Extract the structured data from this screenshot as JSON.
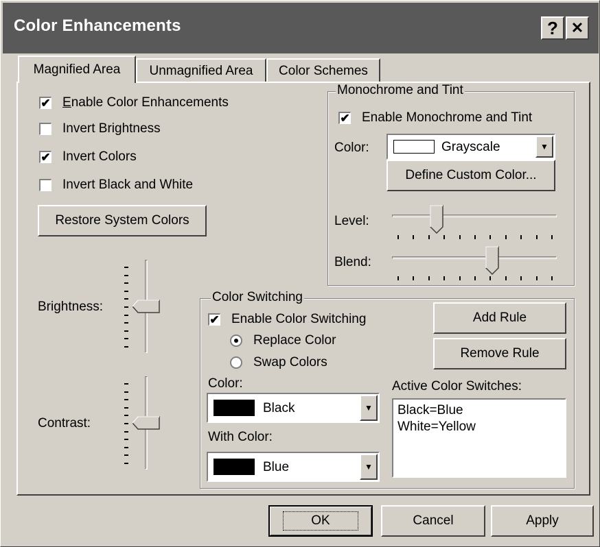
{
  "window": {
    "title": "Color Enhancements",
    "help_glyph": "?",
    "close_glyph": "✕"
  },
  "tabs": [
    {
      "label": "Magnified Area",
      "active": true
    },
    {
      "label": "Unmagnified Area",
      "active": false
    },
    {
      "label": "Color Schemes",
      "active": false
    }
  ],
  "magnified": {
    "options": [
      {
        "label": "Enable Color Enhancements",
        "checked": true
      },
      {
        "label": "Invert Brightness",
        "checked": false
      },
      {
        "label": "Invert Colors",
        "checked": true
      },
      {
        "label": "Invert Black and White",
        "checked": false
      }
    ],
    "restore_button": "Restore System Colors",
    "brightness_label": "Brightness:",
    "contrast_label": "Contrast:",
    "brightness_level": 0.5,
    "contrast_level": 0.5
  },
  "monochrome": {
    "group_label": "Monochrome and Tint",
    "enable_label": "Enable Monochrome and Tint",
    "enable_checked": true,
    "color_label": "Color:",
    "color_value": "Grayscale",
    "define_button": "Define Custom Color...",
    "level_label": "Level:",
    "blend_label": "Blend:",
    "level_value": 0.25,
    "blend_value": 0.62
  },
  "switching": {
    "group_label": "Color Switching",
    "enable_label": "Enable Color Switching",
    "enable_checked": true,
    "replace_label": "Replace Color",
    "swap_label": "Swap Colors",
    "replace_selected": true,
    "color_label": "Color:",
    "color_value": "Black",
    "with_color_label": "With Color:",
    "with_color_value": "Blue",
    "add_rule": "Add Rule",
    "remove_rule": "Remove Rule",
    "active_label": "Active Color Switches:",
    "active_items": [
      "Black=Blue",
      "White=Yellow"
    ]
  },
  "footer": {
    "ok": "OK",
    "cancel": "Cancel",
    "apply": "Apply"
  },
  "colors": {
    "dialog_bg": "#d4d0c8",
    "title_bg": "#595959",
    "swatch_black": "#000000",
    "swatch_white": "#ffffff"
  },
  "icons": {
    "checkmark": "✔",
    "dropdown": "▼"
  }
}
